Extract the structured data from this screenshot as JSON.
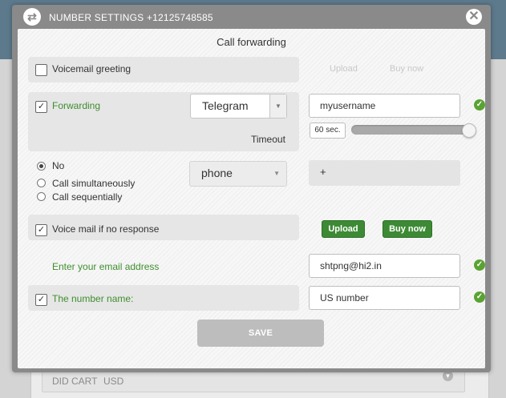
{
  "modal": {
    "title": "NUMBER SETTINGS +12125748585",
    "section_title": "Call forwarding"
  },
  "voicemail_greeting": {
    "label": "Voicemail greeting",
    "checked": false,
    "upload_label": "Upload",
    "buy_label": "Buy now"
  },
  "forwarding": {
    "label": "Forwarding",
    "checked": true,
    "service_select": "Telegram",
    "username_value": "myusername",
    "timeout_label": "Timeout",
    "timeout_value": "60 sec.",
    "timeout_slider_fraction": 1.0
  },
  "call_mode": {
    "options": [
      "No",
      "Call simultaneously",
      "Call sequentially"
    ],
    "selected": "No",
    "type_select": "phone",
    "phone_value": "+"
  },
  "voice_mail_no_response": {
    "label": "Voice mail if no response",
    "checked": true,
    "upload_label": "Upload",
    "buy_label": "Buy now"
  },
  "email": {
    "label": "Enter your email address",
    "value": "shtpng@hi2.in"
  },
  "number_name": {
    "label": "The number name:",
    "checked": true,
    "value": "US number"
  },
  "save_label": "SAVE",
  "background": {
    "row_label": "DID CART",
    "row_currency": "USD"
  },
  "colors": {
    "accent_green": "#3d8a35",
    "label_green": "#3f8e2f",
    "header_gray": "#8a8a8a"
  }
}
